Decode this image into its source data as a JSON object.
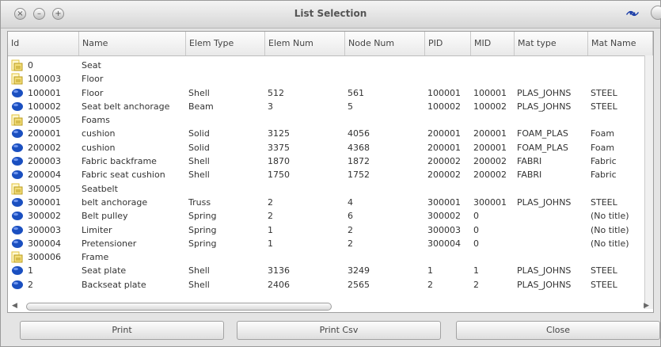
{
  "window": {
    "title": "List Selection",
    "close_glyph": "×",
    "minimize_glyph": "–",
    "maximize_glyph": "+"
  },
  "columns": [
    "Id",
    "Name",
    "Elem Type",
    "Elem Num",
    "Node Num",
    "PID",
    "MID",
    "Mat type",
    "Mat Name"
  ],
  "rows": [
    {
      "icon": "folder",
      "id": "0",
      "name": "Seat",
      "etype": "",
      "enum": "",
      "nnum": "",
      "pid": "",
      "mid": "",
      "mtype": "",
      "mname": ""
    },
    {
      "icon": "folder",
      "id": "100003",
      "name": "Floor",
      "etype": "",
      "enum": "",
      "nnum": "",
      "pid": "",
      "mid": "",
      "mtype": "",
      "mname": ""
    },
    {
      "icon": "part",
      "id": "100001",
      "name": "Floor",
      "etype": "Shell",
      "enum": "512",
      "nnum": "561",
      "pid": "100001",
      "mid": "100001",
      "mtype": "PLAS_JOHNS",
      "mname": "STEEL"
    },
    {
      "icon": "part",
      "id": "100002",
      "name": "Seat belt anchorage",
      "etype": "Beam",
      "enum": "3",
      "nnum": "5",
      "pid": "100002",
      "mid": "100002",
      "mtype": "PLAS_JOHNS",
      "mname": "STEEL"
    },
    {
      "icon": "folder",
      "id": "200005",
      "name": "Foams",
      "etype": "",
      "enum": "",
      "nnum": "",
      "pid": "",
      "mid": "",
      "mtype": "",
      "mname": ""
    },
    {
      "icon": "part",
      "id": "200001",
      "name": "cushion",
      "etype": "Solid",
      "enum": "3125",
      "nnum": "4056",
      "pid": "200001",
      "mid": "200001",
      "mtype": "FOAM_PLAS",
      "mname": "Foam"
    },
    {
      "icon": "part",
      "id": "200002",
      "name": "cushion",
      "etype": "Solid",
      "enum": "3375",
      "nnum": "4368",
      "pid": "200001",
      "mid": "200001",
      "mtype": "FOAM_PLAS",
      "mname": "Foam"
    },
    {
      "icon": "part",
      "id": "200003",
      "name": "Fabric backframe",
      "etype": "Shell",
      "enum": "1870",
      "nnum": "1872",
      "pid": "200002",
      "mid": "200002",
      "mtype": "FABRI",
      "mname": "Fabric"
    },
    {
      "icon": "part",
      "id": "200004",
      "name": "Fabric seat cushion",
      "etype": "Shell",
      "enum": "1750",
      "nnum": "1752",
      "pid": "200002",
      "mid": "200002",
      "mtype": "FABRI",
      "mname": "Fabric"
    },
    {
      "icon": "folder",
      "id": "300005",
      "name": "Seatbelt",
      "etype": "",
      "enum": "",
      "nnum": "",
      "pid": "",
      "mid": "",
      "mtype": "",
      "mname": ""
    },
    {
      "icon": "part",
      "id": "300001",
      "name": "belt anchorage",
      "etype": "Truss",
      "enum": "2",
      "nnum": "4",
      "pid": "300001",
      "mid": "300001",
      "mtype": "PLAS_JOHNS",
      "mname": "STEEL"
    },
    {
      "icon": "part",
      "id": "300002",
      "name": "Belt pulley",
      "etype": "Spring",
      "enum": "2",
      "nnum": "6",
      "pid": "300002",
      "mid": "0",
      "mtype": "",
      "mname": "(No title)"
    },
    {
      "icon": "part",
      "id": "300003",
      "name": "Limiter",
      "etype": "Spring",
      "enum": "1",
      "nnum": "2",
      "pid": "300003",
      "mid": "0",
      "mtype": "",
      "mname": "(No title)"
    },
    {
      "icon": "part",
      "id": "300004",
      "name": "Pretensioner",
      "etype": "Spring",
      "enum": "1",
      "nnum": "2",
      "pid": "300004",
      "mid": "0",
      "mtype": "",
      "mname": "(No title)"
    },
    {
      "icon": "folder",
      "id": "300006",
      "name": "Frame",
      "etype": "",
      "enum": "",
      "nnum": "",
      "pid": "",
      "mid": "",
      "mtype": "",
      "mname": ""
    },
    {
      "icon": "part",
      "id": "1",
      "name": "Seat plate",
      "etype": "Shell",
      "enum": "3136",
      "nnum": "3249",
      "pid": "1",
      "mid": "1",
      "mtype": "PLAS_JOHNS",
      "mname": "STEEL"
    },
    {
      "icon": "part",
      "id": "2",
      "name": "Backseat plate",
      "etype": "Shell",
      "enum": "2406",
      "nnum": "2565",
      "pid": "2",
      "mid": "2",
      "mtype": "PLAS_JOHNS",
      "mname": "STEEL"
    }
  ],
  "buttons": {
    "print": "Print",
    "print_csv": "Print Csv",
    "close": "Close"
  },
  "colors": {
    "part_icon": "#1a4fc0",
    "folder_icon": "#e2c23a"
  }
}
